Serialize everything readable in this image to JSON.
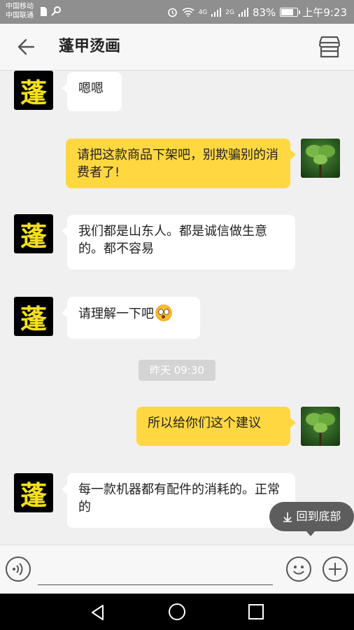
{
  "status_bar": {
    "carrier_1": "中国移动",
    "carrier_2": "中国联通",
    "network_1": "4G",
    "network_2": "2G",
    "battery_percent": "83%",
    "battery_level": 0.83,
    "time": "上午9:23"
  },
  "header": {
    "title": "蓬甲烫画",
    "back_icon": "arrow-left-icon",
    "store_icon": "store-icon"
  },
  "shop_avatar_char": "蓬",
  "messages": [
    {
      "side": "in",
      "text": "嗯嗯"
    },
    {
      "side": "out",
      "text": "请把这款商品下架吧，别欺骗别的消费者了!"
    },
    {
      "side": "in",
      "text": "我们都是山东人。都是诚信做生意的。都不容易"
    },
    {
      "side": "in",
      "text": "请理解一下吧",
      "emoji": "flushed-face-emoji"
    },
    {
      "side": "out",
      "text": "所以给你们这个建议"
    },
    {
      "side": "in",
      "text": "每一款机器都有配件的消耗的。正常的"
    }
  ],
  "timestamp": "昨天 09:30",
  "back_to_bottom_label": "回到底部",
  "input": {
    "value": "",
    "placeholder": ""
  },
  "colors": {
    "outgoing_bubble": "#ffd740",
    "incoming_bubble": "#ffffff",
    "shop_avatar_text": "#f4e11a"
  }
}
